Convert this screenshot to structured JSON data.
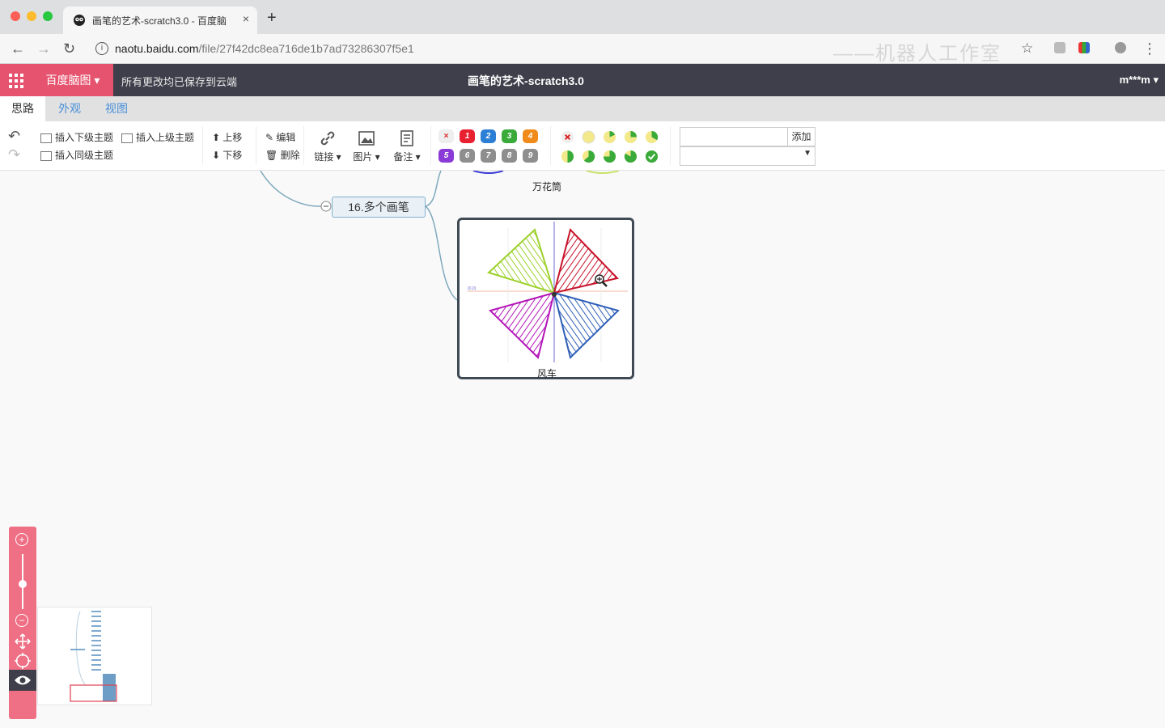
{
  "browser": {
    "tab_title": "画笔的艺术-scratch3.0 - 百度脑",
    "close_glyph": "×",
    "new_tab_glyph": "+",
    "url_host": "naotu.baidu.com",
    "url_path": "/file/27f42dc8ea716de1b7ad73286307f5e1",
    "watermark_text": "——机器人工作室",
    "back_glyph": "←",
    "forward_glyph": "→",
    "reload_glyph": "↻",
    "info_glyph": "i",
    "star_glyph": "☆",
    "menu_glyph": "⋮"
  },
  "header": {
    "brand": "百度脑图 ▾",
    "save_status": "所有更改均已保存到云端",
    "doc_title": "画笔的艺术-scratch3.0",
    "user": "m***m ▾"
  },
  "ribbon": {
    "tabs": [
      "思路",
      "外观",
      "视图"
    ],
    "undo_glyph": "↶",
    "redo_glyph": "↷",
    "insert_child": "插入下级主题",
    "insert_parent": "插入上级主题",
    "insert_sibling": "插入同级主题",
    "move_up": "上移",
    "move_down": "下移",
    "edit": "编辑",
    "delete": "删除",
    "link": "链接 ▾",
    "image": "图片 ▾",
    "note": "备注 ▾",
    "priority": [
      "×",
      "1",
      "2",
      "3",
      "4",
      "5",
      "6",
      "7",
      "8",
      "9"
    ],
    "add_tag": "添加"
  },
  "colors": {
    "accent": "#e6536f",
    "header_bg": "#3f3f4b",
    "link_blue": "#4a90d9",
    "priority_colors": [
      "#e0e0e0",
      "#e8202f",
      "#2d7fd6",
      "#3aab3a",
      "#f08a1a",
      "#8a3ad6",
      "#8e8e8e",
      "#8e8e8e",
      "#8e8e8e",
      "#8e8e8e"
    ]
  },
  "canvas": {
    "topic_node": "16.多个画笔",
    "caption_top": "万花筒",
    "caption_image": "风车",
    "image_axis_label": "(0,0)"
  },
  "icons": {
    "zoom_in": "zoom-in-icon",
    "zoom_out": "zoom-out-icon",
    "move": "move-icon",
    "locate": "locate-icon",
    "eye": "eye-icon"
  }
}
